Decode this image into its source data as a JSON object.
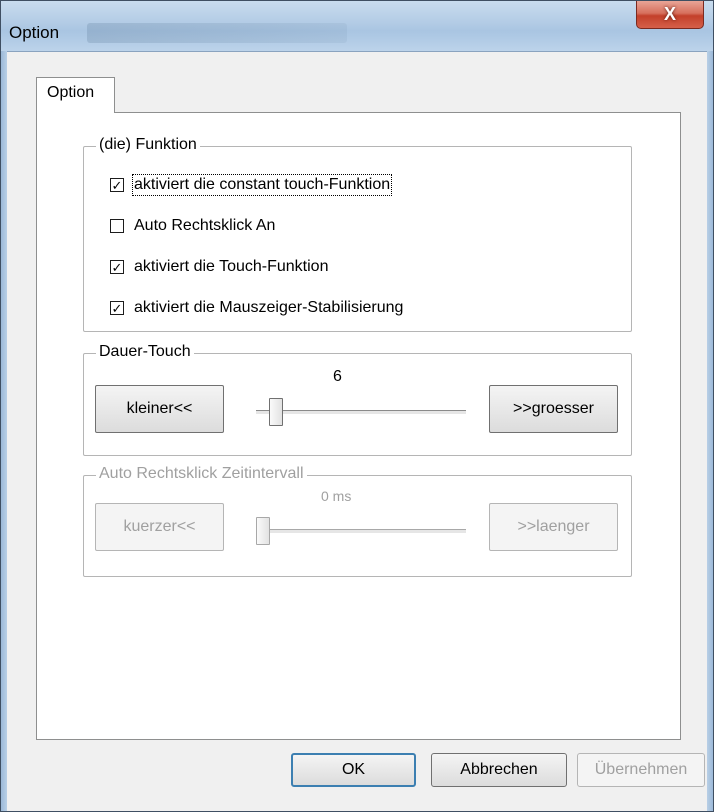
{
  "window": {
    "title": "Option",
    "close_glyph": "X"
  },
  "tab": {
    "label": "Option"
  },
  "function_group": {
    "legend": "(die) Funktion",
    "items": [
      {
        "label": "aktiviert die constant touch-Funktion",
        "checked_mark": "✓",
        "checked": true
      },
      {
        "label": "Auto Rechtsklick An",
        "checked_mark": "",
        "checked": false
      },
      {
        "label": "aktiviert die Touch-Funktion",
        "checked_mark": "✓",
        "checked": true
      },
      {
        "label": "aktiviert die Mauszeiger-Stabilisierung",
        "checked_mark": "✓",
        "checked": true
      }
    ]
  },
  "dauer_group": {
    "legend": "Dauer-Touch",
    "value": "6",
    "decrease_label": "kleiner<<",
    "increase_label": ">>groesser"
  },
  "auto_group": {
    "legend": "Auto Rechtsklick Zeitintervall",
    "value": "0 ms",
    "decrease_label": "kuerzer<<",
    "increase_label": ">>laenger"
  },
  "footer": {
    "ok_label": "OK",
    "cancel_label": "Abbrechen",
    "apply_label": "Übernehmen"
  },
  "colors": {
    "title_bar": "#b5cde6",
    "close_button": "#c3402a",
    "default_button_border": "#3c7fb1"
  }
}
